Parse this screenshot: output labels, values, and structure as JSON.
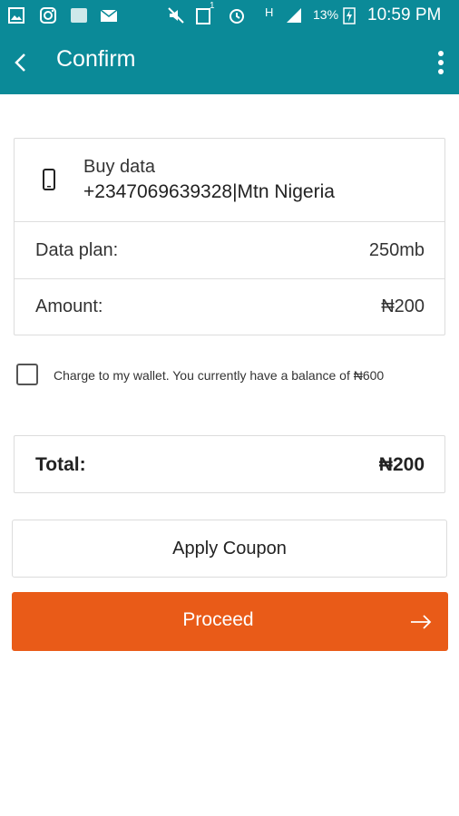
{
  "status_bar": {
    "battery": "13%",
    "time": "10:59 PM",
    "network": "H",
    "notification_count": "1",
    "icons": [
      "gallery-icon",
      "instagram-icon",
      "truecaller-icon",
      "email-icon",
      "mute-icon",
      "phone-notification-icon",
      "alarm-icon",
      "signal-icon",
      "battery-charging-icon"
    ]
  },
  "app_bar": {
    "title": "Confirm",
    "back_icon": "back-arrow-icon",
    "menu_icon": "more-vert-icon"
  },
  "order": {
    "type_label": "Buy data",
    "number_network": "+2347069639328|Mtn Nigeria",
    "icon": "smartphone-icon",
    "rows": [
      {
        "label": "Data plan:",
        "value": "250mb"
      },
      {
        "label": "Amount:",
        "value": "₦200"
      }
    ]
  },
  "wallet": {
    "checked": false,
    "text": "Charge to my wallet. You currently have a balance of ₦600"
  },
  "total": {
    "label": "Total:",
    "value": "₦200"
  },
  "buttons": {
    "coupon": "Apply Coupon",
    "proceed": "Proceed",
    "proceed_icon": "arrow-right-icon"
  },
  "colors": {
    "primary": "#0b8a98",
    "accent": "#e95b18"
  }
}
